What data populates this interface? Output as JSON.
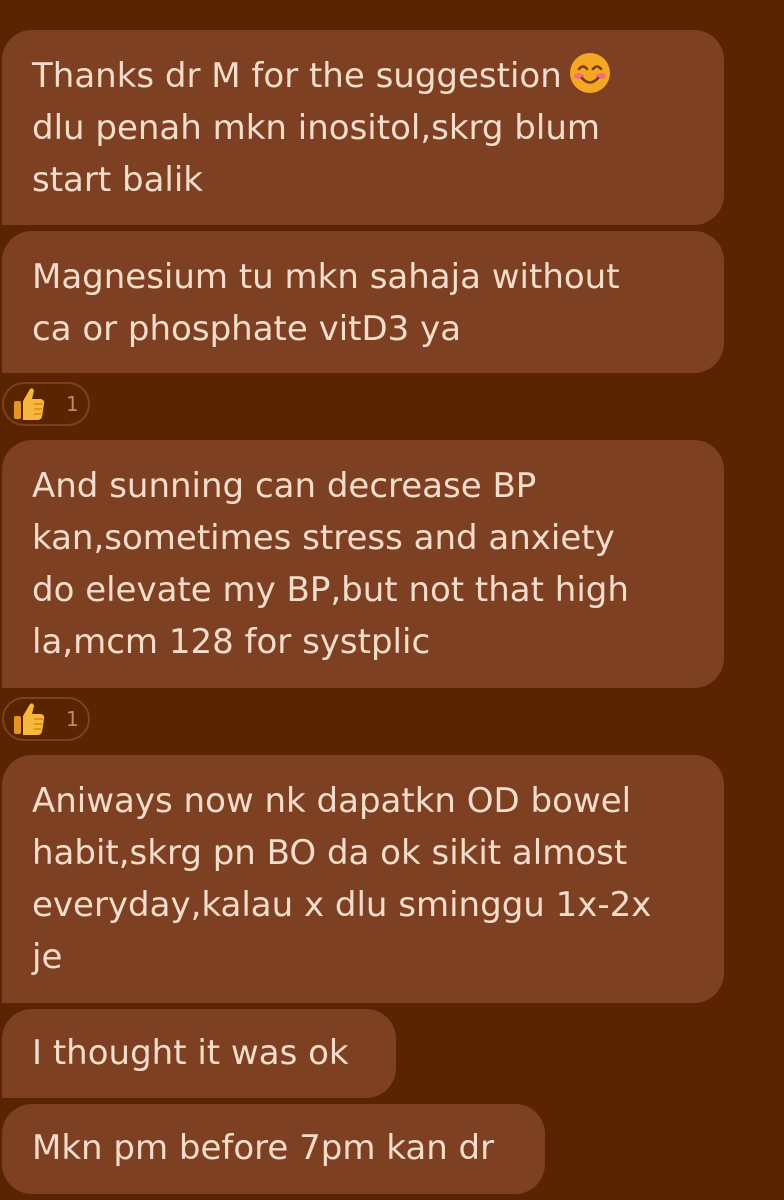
{
  "theme": {
    "background": "#5a2400",
    "bubble": "#7d4023",
    "text": "#f4dccb",
    "reaction_count_text": "#b88b6f"
  },
  "messages": [
    {
      "lines": [
        "Thanks dr M for the suggestion",
        "dlu penah mkn inositol,skrg blum",
        "start balik"
      ],
      "trailing_emoji": "smiling-face-with-smiling-eyes"
    },
    {
      "lines": [
        "Magnesium tu mkn sahaja without",
        "ca or phosphate vitD3 ya"
      ],
      "reaction": {
        "emoji": "thumbs-up",
        "count": "1"
      }
    },
    {
      "lines": [
        "And sunning can decrease BP",
        "kan,sometimes stress and anxiety",
        "do elevate my BP,but not that high",
        "la,mcm 128 for systplic"
      ],
      "reaction": {
        "emoji": "thumbs-up",
        "count": "1"
      }
    },
    {
      "lines": [
        "Aniways now nk dapatkn OD bowel",
        "habit,skrg pn BO da ok sikit almost",
        "everyday,kalau x dlu sminggu 1x-2x",
        "je"
      ]
    },
    {
      "lines": [
        "I thought it was ok"
      ]
    },
    {
      "lines": [
        "Mkn pm before 7pm kan dr"
      ]
    }
  ]
}
